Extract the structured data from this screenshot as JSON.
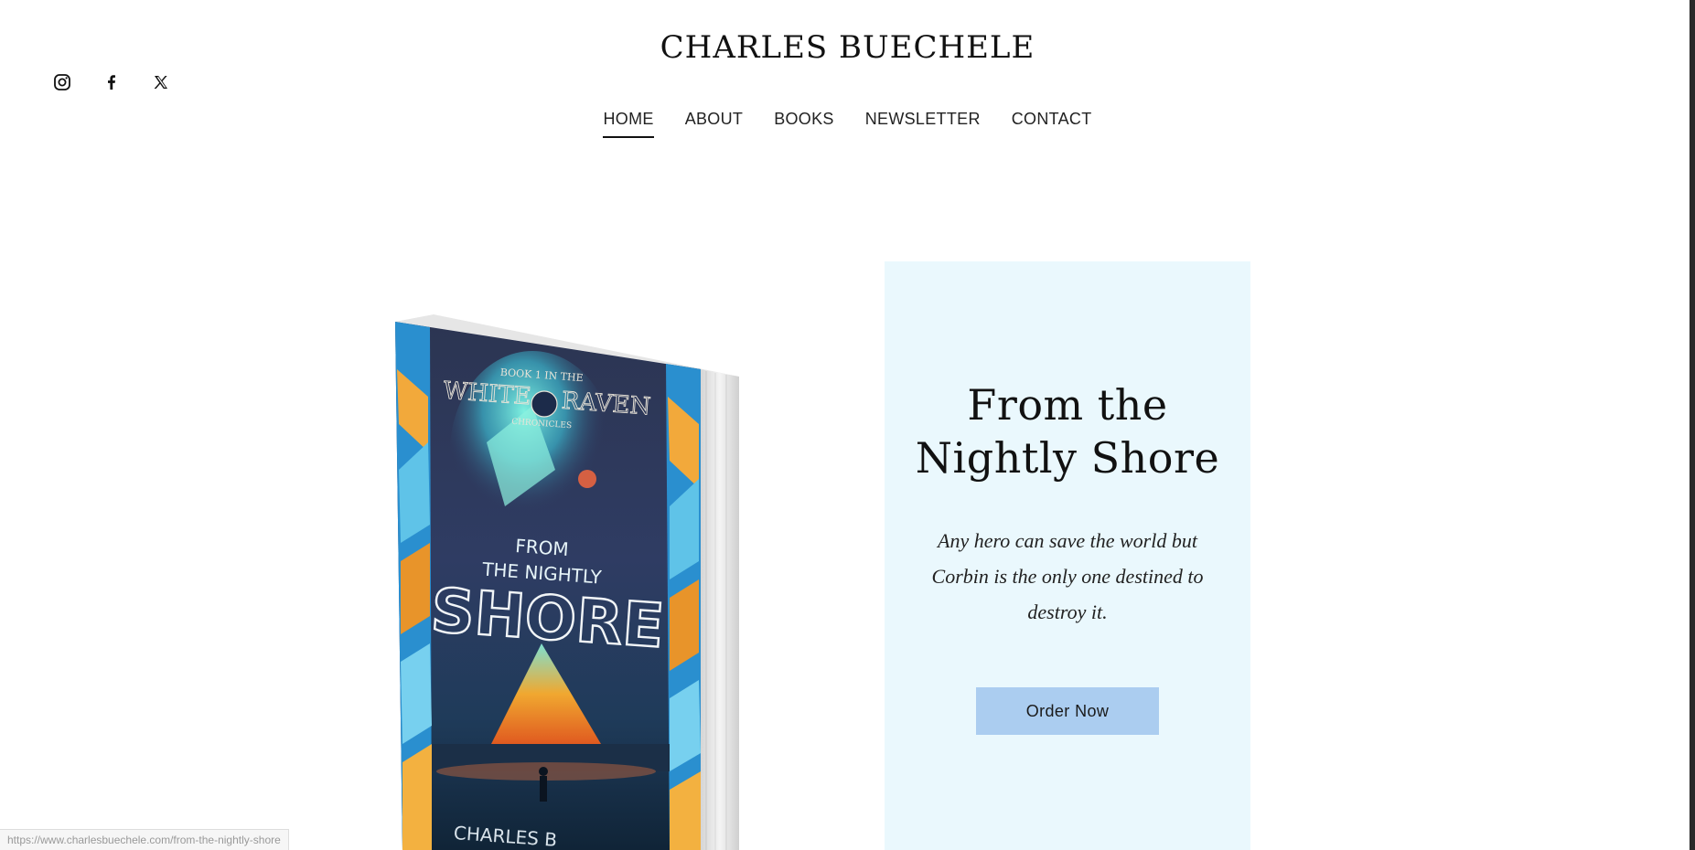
{
  "site": {
    "title": "CHARLES BUECHELE"
  },
  "social": [
    {
      "icon": "instagram-icon",
      "label": "Instagram"
    },
    {
      "icon": "facebook-icon",
      "label": "Facebook"
    },
    {
      "icon": "x-icon",
      "label": "X"
    }
  ],
  "nav": {
    "items": [
      {
        "label": "HOME",
        "active": true
      },
      {
        "label": "ABOUT"
      },
      {
        "label": "BOOKS"
      },
      {
        "label": "NEWSLETTER"
      },
      {
        "label": "CONTACT"
      }
    ]
  },
  "book_cover": {
    "series_top": "BOOK 1 IN THE",
    "series_name_left": "WHITE",
    "series_name_right": "RAVEN",
    "series_sub": "CHRONICLES",
    "title_line1": "FROM",
    "title_line2": "THE NIGHTLY",
    "title_main": "SHORE",
    "author": "CHARLES B"
  },
  "promo": {
    "title": "From the Nightly Shore",
    "tagline": "Any hero can save the world but Corbin is the only one destined to destroy it.",
    "button_label": "Order Now",
    "background": "#eaf8fd",
    "button_color": "#abcdf0"
  },
  "status_bar": {
    "url": "https://www.charlesbuechele.com/from-the-nightly-shore"
  }
}
